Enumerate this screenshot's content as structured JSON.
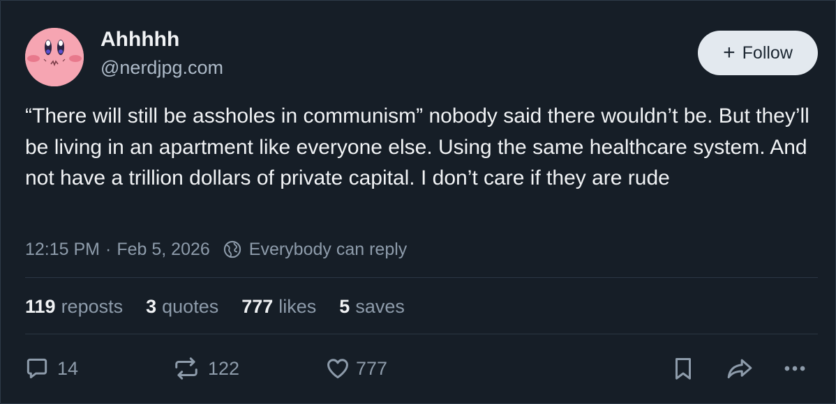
{
  "author": {
    "display_name": "Ahhhhh",
    "handle": "@nerdjpg.com"
  },
  "follow_button": {
    "icon": "+",
    "label": "Follow"
  },
  "post": {
    "text": "“There will still be assholes in communism” nobody said there wouldn’t be. But they’ll be living in an apartment like everyone else. Using the same healthcare system. And not have a trillion dollars of private capital. I don’t care if they are rude",
    "time": "12:15 PM",
    "separator": "·",
    "date": "Feb 5, 2026",
    "reply_setting": "Everybody can reply"
  },
  "stats": {
    "reposts": {
      "count": "119",
      "label": "reposts"
    },
    "quotes": {
      "count": "3",
      "label": "quotes"
    },
    "likes": {
      "count": "777",
      "label": "likes"
    },
    "saves": {
      "count": "5",
      "label": "saves"
    }
  },
  "actions": {
    "reply": {
      "icon": "speech-bubble-icon",
      "count": "14"
    },
    "repost": {
      "icon": "repost-arrows-icon",
      "count": "122"
    },
    "like": {
      "icon": "heart-icon",
      "count": "777"
    },
    "bookmark": {
      "icon": "bookmark-icon"
    },
    "share": {
      "icon": "share-arrow-icon"
    },
    "more": {
      "icon": "ellipsis-icon"
    }
  },
  "colors": {
    "background": "#161e27",
    "text": "#f1f3f5",
    "muted": "#8e9cab",
    "button_bg": "#e3e9ef",
    "avatar": "#f6a5b2"
  }
}
